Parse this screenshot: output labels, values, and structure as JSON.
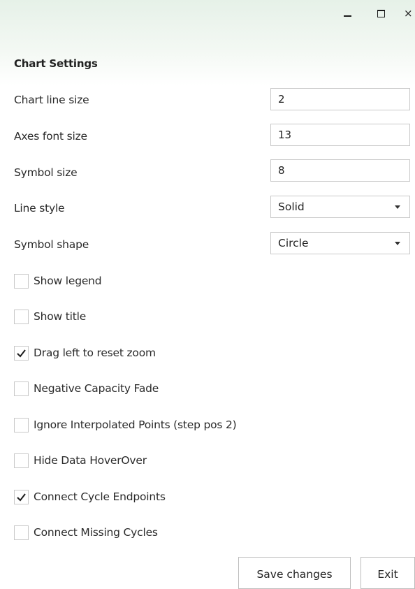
{
  "window": {
    "minimize_icon": "minimize-icon",
    "maximize_icon": "maximize-icon",
    "close_glyph": "×"
  },
  "settings": {
    "title": "Chart Settings",
    "fields": [
      {
        "label": "Chart line size",
        "value": "2"
      },
      {
        "label": "Axes font size",
        "value": "13"
      },
      {
        "label": "Symbol size",
        "value": "8"
      }
    ],
    "selects": [
      {
        "label": "Line style",
        "value": "Solid"
      },
      {
        "label": "Symbol shape",
        "value": "Circle"
      }
    ],
    "checkboxes": [
      {
        "label": "Show legend",
        "checked": false
      },
      {
        "label": "Show title",
        "checked": false
      },
      {
        "label": "Drag left to reset zoom",
        "checked": true
      },
      {
        "label": "Negative Capacity Fade",
        "checked": false
      },
      {
        "label": "Ignore Interpolated Points (step pos 2)",
        "checked": false
      },
      {
        "label": "Hide Data HoverOver",
        "checked": false
      },
      {
        "label": "Connect Cycle Endpoints",
        "checked": true
      },
      {
        "label": "Connect Missing Cycles",
        "checked": false
      }
    ]
  },
  "buttons": {
    "save_label": "Save changes",
    "exit_label": "Exit"
  },
  "colors": {
    "header_gradient_top": "#e6f1e8",
    "border": "#c9c9c9",
    "text": "#222222"
  }
}
